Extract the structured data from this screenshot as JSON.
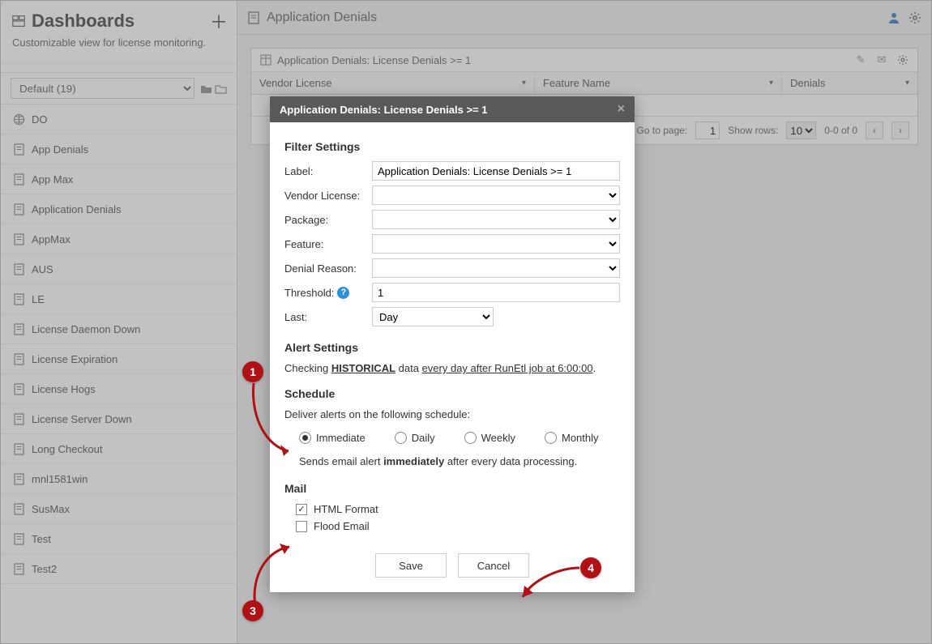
{
  "sidebar": {
    "title": "Dashboards",
    "subtitle": "Customizable view for license monitoring.",
    "selected": "Default (19)",
    "items": [
      {
        "label": "DO",
        "icon": "globe"
      },
      {
        "label": "App Denials",
        "icon": "dash"
      },
      {
        "label": "App Max",
        "icon": "dash"
      },
      {
        "label": "Application Denials",
        "icon": "dash"
      },
      {
        "label": "AppMax",
        "icon": "dash"
      },
      {
        "label": "AUS",
        "icon": "dash"
      },
      {
        "label": "LE",
        "icon": "dash"
      },
      {
        "label": "License Daemon Down",
        "icon": "dash"
      },
      {
        "label": "License Expiration",
        "icon": "dash"
      },
      {
        "label": "License Hogs",
        "icon": "dash"
      },
      {
        "label": "License Server Down",
        "icon": "dash"
      },
      {
        "label": "Long Checkout",
        "icon": "dash"
      },
      {
        "label": "mnl1581win",
        "icon": "dash"
      },
      {
        "label": "SusMax",
        "icon": "dash"
      },
      {
        "label": "Test",
        "icon": "dash"
      },
      {
        "label": "Test2",
        "icon": "dash"
      }
    ]
  },
  "header": {
    "title": "Application Denials"
  },
  "grid": {
    "title": "Application Denials: License Denials >= 1",
    "columns": [
      "Vendor License",
      "Feature Name",
      "Denials"
    ],
    "pager": {
      "goto_label": "Go to page:",
      "page": "1",
      "showrows_label": "Show rows:",
      "rows": "10",
      "range": "0-0 of 0"
    }
  },
  "dialog": {
    "title": "Application Denials: License Denials >= 1",
    "filter_h": "Filter Settings",
    "labels": {
      "label": "Label:",
      "vendor": "Vendor License:",
      "package": "Package:",
      "feature": "Feature:",
      "reason": "Denial Reason:",
      "threshold": "Threshold:",
      "last": "Last:"
    },
    "values": {
      "label": "Application Denials: License Denials >= 1",
      "threshold": "1",
      "last": "Day"
    },
    "alert_h": "Alert Settings",
    "alert_line_pre": "Checking ",
    "alert_line_hist": "HISTORICAL",
    "alert_line_mid": " data ",
    "alert_line_sched": "every day after RunEtl job at 6:00:00",
    "schedule_h": "Schedule",
    "schedule_desc": "Deliver alerts on the following schedule:",
    "radios": {
      "immediate": "Immediate",
      "daily": "Daily",
      "weekly": "Weekly",
      "monthly": "Monthly"
    },
    "schedule_note_pre": "Sends email alert ",
    "schedule_note_b": "immediately",
    "schedule_note_post": " after every data processing.",
    "mail_h": "Mail",
    "mail_html": "HTML Format",
    "mail_flood": "Flood Email",
    "save": "Save",
    "cancel": "Cancel"
  },
  "callouts": {
    "c1": "1",
    "c3": "3",
    "c4": "4"
  }
}
